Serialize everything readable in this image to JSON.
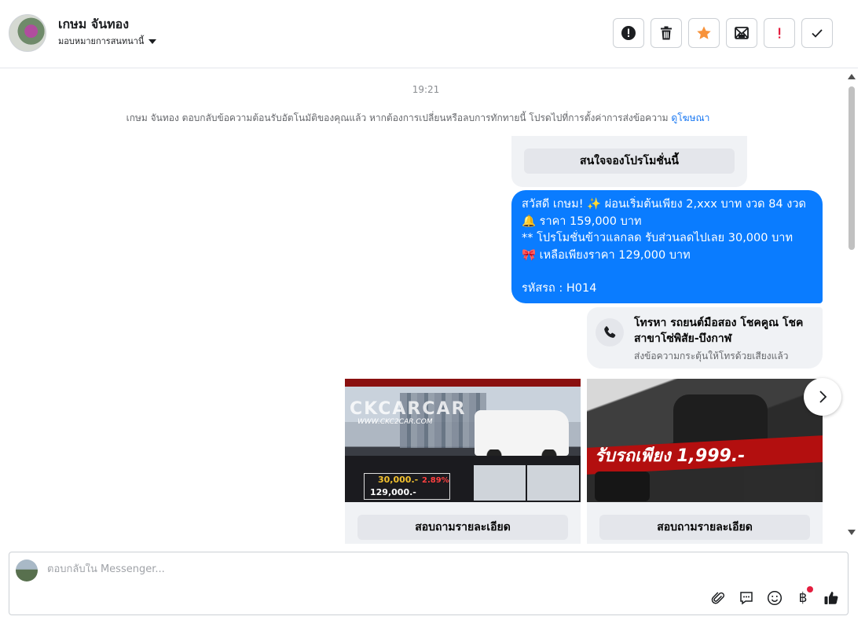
{
  "header": {
    "contact_name": "เกษม จันทอง",
    "assign_label": "มอบหมายการสนทนานี้",
    "actions": [
      {
        "name": "mark-spam-button",
        "icon": "alert-circle-icon"
      },
      {
        "name": "delete-button",
        "icon": "trash-icon"
      },
      {
        "name": "star-button",
        "icon": "star-icon"
      },
      {
        "name": "mark-unread-button",
        "icon": "envelope-icon"
      },
      {
        "name": "follow-up-button",
        "icon": "exclamation-icon"
      },
      {
        "name": "mark-done-button",
        "icon": "check-icon"
      }
    ]
  },
  "conversation": {
    "timestamp": "19:21",
    "system_message": "เกษม จันทอง ตอบกลับข้อความต้อนรับอัตโนมัติของคุณแล้ว หากต้องการเปลี่ยนหรือลบการทักทายนี้ โปรดไปที่การตั้งค่าการส่งข้อความ",
    "system_link": "ดูโฆษณา",
    "quick_reply": "สนใจจองโปรโมชั่นนี้",
    "bubble_lines": [
      "สวัสดี เกษม! ✨  ผ่อนเริ่มต้นเพียง 2,xxx บาท งวด 84 งวด",
      "🔔 ราคา 159,000 บาท",
      "** โปรโมชั่นข้าวแลกลด รับส่วนลดไปเลย 30,000 บาท",
      "🎀  เหลือเพียงราคา 129,000 บาท",
      "",
      " รหัสรถ : H014"
    ],
    "call_card": {
      "title": "โทรหา รถยนต์มือสอง โชคคูณ โชค สาขาโซ่พิสัย-บึงกาฬ",
      "subtitle": "ส่งข้อความกระตุ้นให้โทรด้วยเสียงแล้ว"
    },
    "carousel": [
      {
        "button": "สอบถามรายละเอียด",
        "image": {
          "watermark": "CKCARCAR",
          "url": "WWW.CKC2CAR.COM",
          "price_down": "30,000.-",
          "price_total": "129,000.-",
          "rate": "2.89%"
        }
      },
      {
        "button": "สอบถามรายละเอียด",
        "image": {
          "banner": "รับรถเพียง 1,999.-"
        }
      }
    ]
  },
  "composer": {
    "placeholder": "ตอบกลับใน Messenger...",
    "tools": [
      "paperclip-icon",
      "saved-replies-icon",
      "emoji-icon",
      "baht-payment-icon",
      "thumbs-up-icon"
    ],
    "baht_symbol": "฿"
  },
  "colors": {
    "accent": "#0a7cff",
    "star": "#f7923a",
    "alert_red": "#e41e3f",
    "link": "#1877f2"
  }
}
